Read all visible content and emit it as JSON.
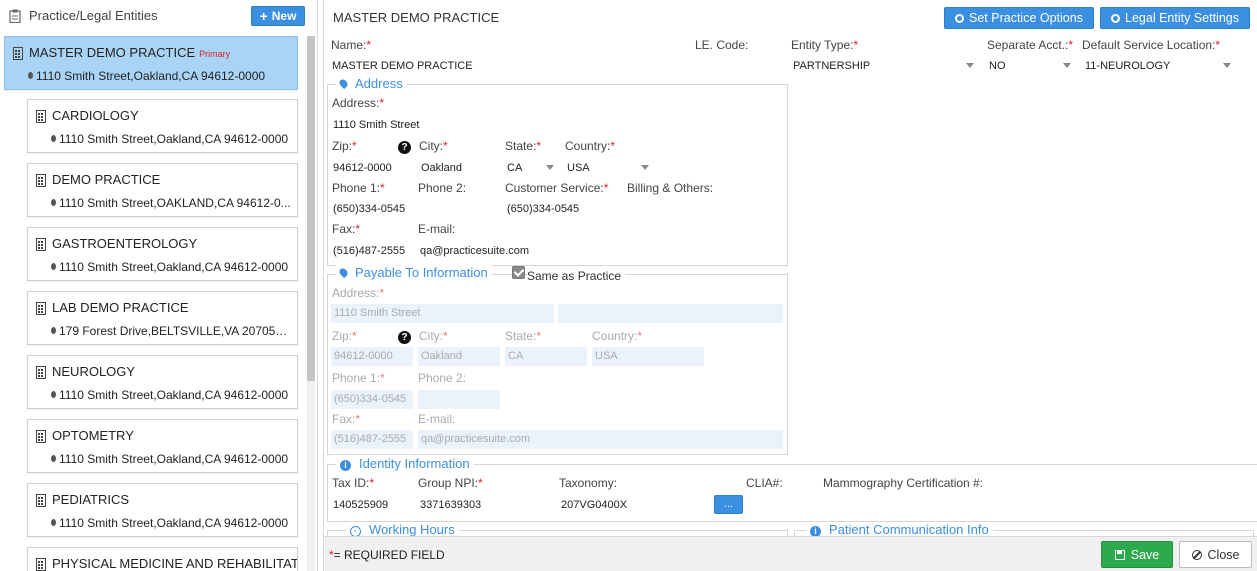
{
  "left_panel": {
    "title": "Practice/Legal Entities",
    "new_button": "New",
    "entities": [
      {
        "name": "MASTER DEMO PRACTICE",
        "badge": "Primary",
        "address": "1110 Smith Street,Oakland,CA 94612-0000"
      },
      {
        "name": "CARDIOLOGY",
        "address": "1110 Smith Street,Oakland,CA 94612-0000"
      },
      {
        "name": "DEMO PRACTICE",
        "address": "1110 Smith Street,OAKLAND,CA 94612-0..."
      },
      {
        "name": "GASTROENTEROLOGY",
        "address": "1110 Smith Street,Oakland,CA 94612-0000"
      },
      {
        "name": "LAB DEMO PRACTICE",
        "address": "179 Forest Drive,BELTSVILLE,VA 20705-0..."
      },
      {
        "name": "NEUROLOGY",
        "address": "1110 Smith Street,Oakland,CA 94612-0000"
      },
      {
        "name": "OPTOMETRY",
        "address": "1110 Smith Street,Oakland,CA 94612-0000"
      },
      {
        "name": "PEDIATRICS",
        "address": "1110 Smith Street,Oakland,CA 94612-0000"
      },
      {
        "name": "PHYSICAL MEDICINE AND REHABILITATION",
        "address": ""
      }
    ]
  },
  "header": {
    "title": "MASTER DEMO PRACTICE",
    "set_practice_options": "Set Practice Options",
    "legal_entity_settings": "Legal Entity Settings"
  },
  "top_fields": {
    "name_label": "Name:",
    "name_value": "MASTER DEMO PRACTICE",
    "le_code_label": "LE. Code:",
    "entity_type_label": "Entity Type:",
    "entity_type_value": "PARTNERSHIP",
    "separate_acct_label": "Separate Acct.:",
    "separate_acct_value": "NO",
    "default_location_label": "Default Service Location:",
    "default_location_value": "11-NEUROLOGY"
  },
  "address": {
    "section_title": "Address",
    "address_label": "Address:",
    "address_value": "1110 Smith Street",
    "zip_label": "Zip:",
    "zip_value": "94612-0000",
    "city_label": "City:",
    "city_value": "Oakland",
    "state_label": "State:",
    "state_value": "CA",
    "country_label": "Country:",
    "country_value": "USA",
    "phone1_label": "Phone 1:",
    "phone1_value": "(650)334-0545",
    "phone2_label": "Phone 2:",
    "customer_service_label": "Customer Service:",
    "customer_service_value": "(650)334-0545",
    "billing_label": "Billing & Others:",
    "fax_label": "Fax:",
    "fax_value": "(516)487-2555",
    "email_label": "E-mail:",
    "email_value": "qa@practicesuite.com"
  },
  "payable": {
    "section_title": "Payable To Information",
    "same_as_practice": "Same as Practice",
    "address_label": "Address:",
    "address_value": "1110 Smith Street",
    "zip_label": "Zip:",
    "zip_value": "94612-0000",
    "city_label": "City:",
    "city_value": "Oakland",
    "state_label": "State:",
    "state_value": "CA",
    "country_label": "Country:",
    "country_value": "USA",
    "phone1_label": "Phone 1:",
    "phone1_value": "(650)334-0545",
    "phone2_label": "Phone 2:",
    "fax_label": "Fax:",
    "fax_value": "(516)487-2555",
    "email_label": "E-mail:",
    "email_value": "qa@practicesuite.com"
  },
  "identity": {
    "section_title": "Identity Information",
    "tax_id_label": "Tax ID:",
    "tax_id_value": "140525909",
    "group_npi_label": "Group NPI:",
    "group_npi_value": "3371639303",
    "taxonomy_label": "Taxonomy:",
    "taxonomy_value": "207VG0400X",
    "clia_label": "CLIA#:",
    "mammography_label": "Mammography Certification #:",
    "dots_button": "..."
  },
  "lower_sections": {
    "working_hours": "Working Hours",
    "patient_communication": "Patient Communication Info"
  },
  "footer": {
    "required_star": "*",
    "required_text": "= REQUIRED FIELD",
    "save": "Save",
    "close": "Close"
  },
  "colors": {
    "accent": "#3b8fe0",
    "selected_bg": "#a9d4f5",
    "required": "#d9232a",
    "save": "#2eaa4e"
  },
  "icons": [
    "clipboard-icon",
    "plus-icon",
    "building-icon",
    "map-marker-icon",
    "gear-icon",
    "info-icon",
    "question-icon",
    "clock-icon",
    "save-icon",
    "ban-icon"
  ]
}
